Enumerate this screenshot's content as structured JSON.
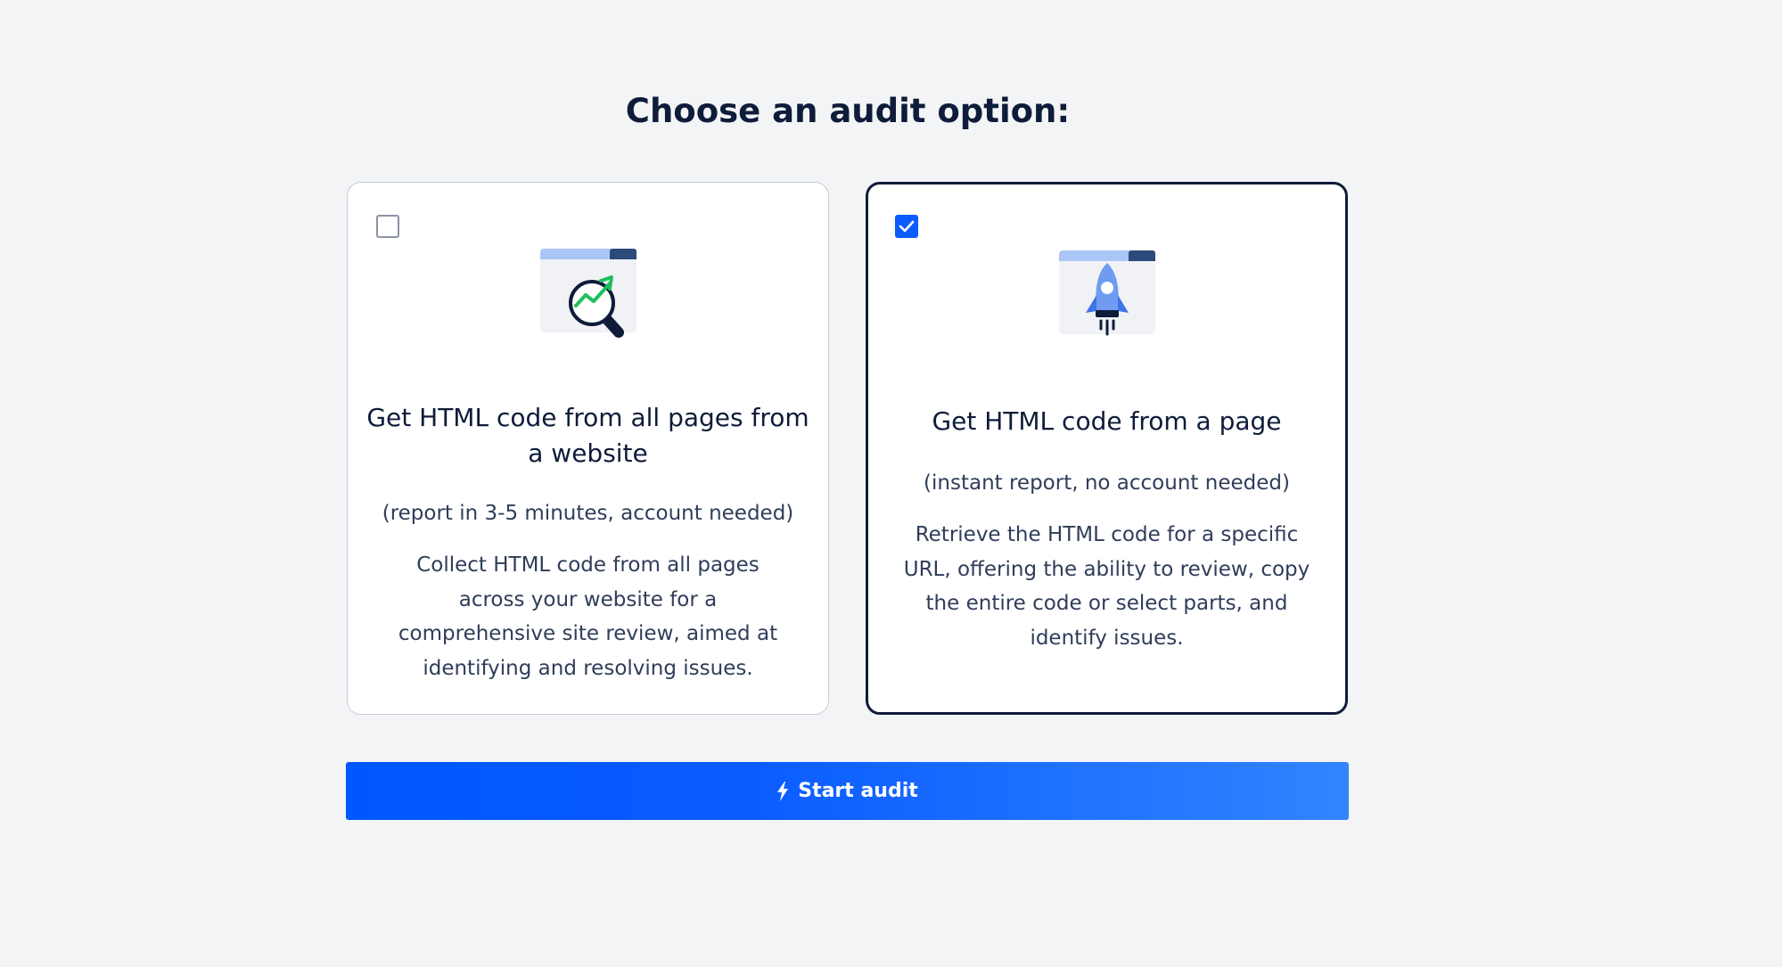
{
  "heading": "Choose an audit option:",
  "options": [
    {
      "checked": false,
      "icon": "magnifier-chart-icon",
      "title": "Get HTML code from all pages from a website",
      "subtitle": "(report in 3-5 minutes, account needed)",
      "description": "Collect HTML code from all pages across your website for a comprehensive site review, aimed at identifying and resolving issues."
    },
    {
      "checked": true,
      "icon": "rocket-icon",
      "title": "Get HTML code from a page",
      "subtitle": "(instant report, no account needed)",
      "description": "Retrieve the HTML code for a specific URL, offering the ability to review, copy the entire code or select parts, and identify issues."
    }
  ],
  "start_button": {
    "label": "Start audit",
    "icon": "lightning-icon"
  },
  "colors": {
    "background": "#f3f4f6",
    "primary": "#0a5cff",
    "dark_text": "#0e1c3a",
    "selected_border": "#0e1c3a",
    "chart_green": "#1fbf5c"
  }
}
